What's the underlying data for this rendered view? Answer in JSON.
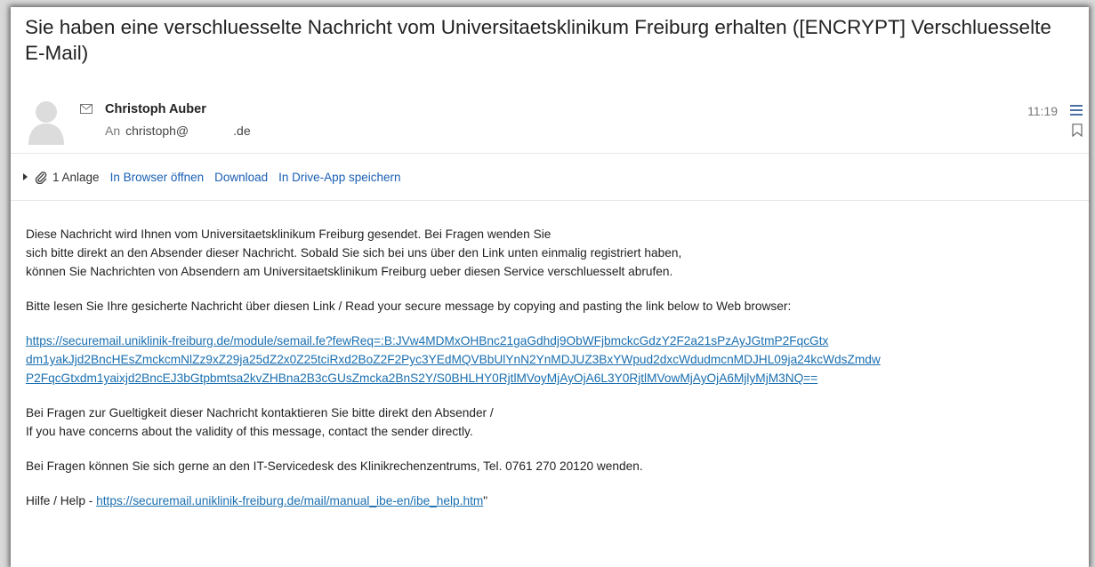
{
  "email": {
    "subject": "Sie haben eine verschluesselte Nachricht vom Universitaetsklinikum Freiburg erhalten ([ENCRYPT] Verschluesselte E-Mail)",
    "sender_name": "Christoph Auber",
    "to_label": "An",
    "to_local": "christoph@",
    "to_domain": ".de",
    "time": "11:19"
  },
  "attachments": {
    "count_label": "1 Anlage",
    "open_browser": "In Browser öffnen",
    "download": "Download",
    "save_drive": "In Drive-App speichern"
  },
  "body": {
    "intro_lines": [
      "Diese Nachricht wird Ihnen vom Universitaetsklinikum Freiburg gesendet. Bei Fragen wenden Sie",
      "sich bitte direkt an den Absender dieser Nachricht. Sobald Sie sich bei uns über den Link unten einmalig registriert haben,",
      "können Sie Nachrichten von Absendern am Universitaetsklinikum Freiburg ueber diesen Service verschluesselt abrufen."
    ],
    "read_prompt": "Bitte lesen Sie Ihre gesicherte Nachricht über diesen Link / Read your secure message by copying and pasting the link below to Web browser:",
    "secure_link_lines": [
      "https://securemail.uniklinik-freiburg.de/module/semail.fe?fewReq=:B:JVw4MDMxOHBnc21gaGdhdj9ObWFjbmckcGdzY2F2a21sPzAyJGtmP2FqcGtx",
      "dm1yakJjd2BncHEsZmckcmNlZz9xZ29ja25dZ2x0Z25tciRxd2BoZ2F2Pyc3YEdMQVBbUlYnN2YnMDJUZ3BxYWpud2dxcWdudmcnMDJHL09ja24kcWdsZmdw",
      "P2FqcGtxdm1yaixjd2BncEJ3bGtpbmtsa2kvZHBna2B3cGUsZmcka2BnS2Y/S0BHLHY0RjtlMVoyMjAyOjA6L3Y0RjtlMVowMjAyOjA6MjlyMjM3NQ=="
    ],
    "validity_lines": [
      "Bei Fragen zur Gueltigkeit dieser Nachricht kontaktieren Sie bitte direkt den Absender /",
      "If you have concerns about the validity of this message, contact the sender  directly."
    ],
    "servicedesk": "Bei Fragen können Sie sich gerne an den IT-Servicedesk des Klinikrechenzentrums, Tel. 0761 270 20120 wenden.",
    "help_prefix": "Hilfe / Help - ",
    "help_link": "https://securemail.uniklinik-freiburg.de/mail/manual_ibe-en/ibe_help.htm",
    "help_suffix": "\""
  },
  "icons": {
    "avatar": "avatar-icon",
    "envelope": "envelope-icon",
    "menu": "menu-icon",
    "bookmark": "bookmark-icon",
    "expand": "expand-triangle-icon",
    "paperclip": "paperclip-icon"
  },
  "colors": {
    "link": "#1a6fb0",
    "action_link": "#1a5fb4",
    "text": "#222222"
  }
}
